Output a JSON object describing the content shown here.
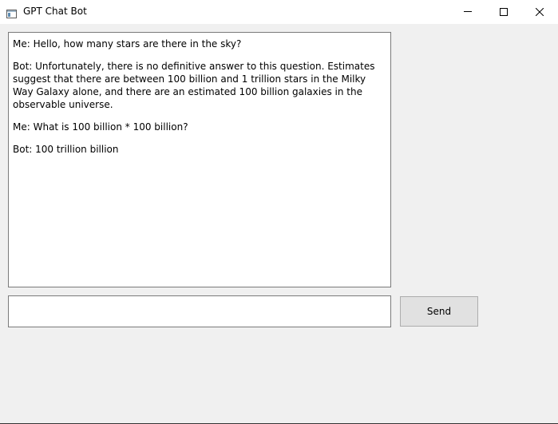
{
  "window": {
    "title": "GPT Chat Bot",
    "app_icon": "window-app-icon",
    "controls": {
      "minimize_icon": "minimize-icon",
      "maximize_icon": "maximize-icon",
      "close_icon": "close-icon"
    }
  },
  "chat": {
    "messages": [
      {
        "text": "Me: Hello, how many stars are there in the sky?"
      },
      {
        "text": "Bot: Unfortunately, there is no definitive answer to this question. Estimates suggest that there are between 100 billion and 1 trillion stars in the Milky Way Galaxy alone, and there are an estimated 100 billion galaxies in the observable universe."
      },
      {
        "text": "Me: What is 100 billion * 100 billion?"
      },
      {
        "text": "Bot: 100 trillion billion"
      }
    ]
  },
  "input": {
    "value": "",
    "placeholder": ""
  },
  "send_button": {
    "label": "Send"
  }
}
